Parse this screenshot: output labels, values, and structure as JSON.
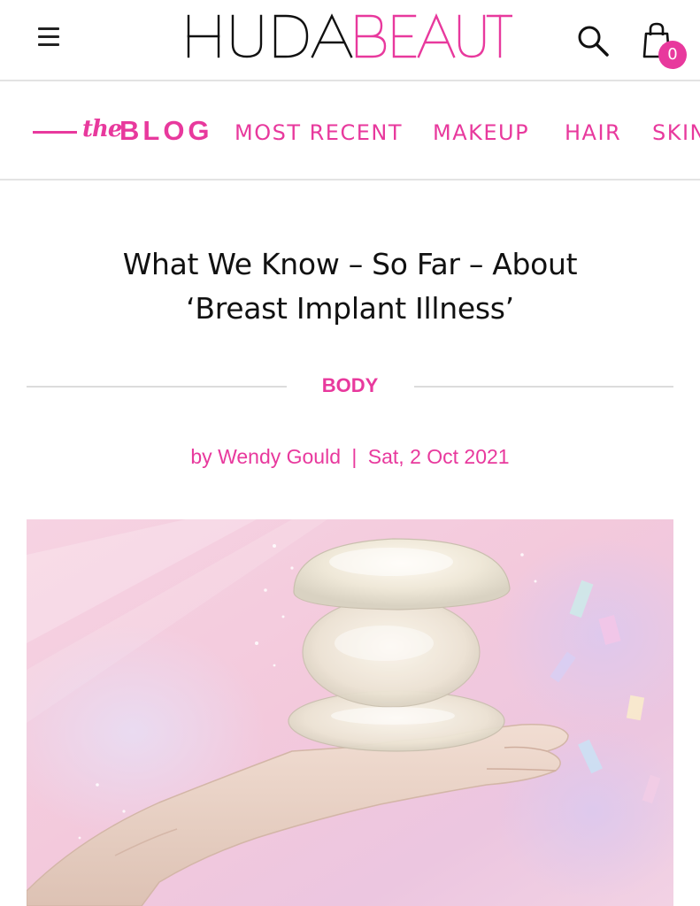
{
  "header": {
    "logo_text": "HUDABEAUTY",
    "cart_count": "0",
    "icons": {
      "menu": "hamburger-menu-icon",
      "search": "search-icon",
      "cart": "shopping-bag-icon"
    }
  },
  "blog_nav": {
    "brand_script": "the",
    "brand_word": "BLOG",
    "items": [
      {
        "label": "MOST RECENT"
      },
      {
        "label": "MAKEUP"
      },
      {
        "label": "HAIR"
      },
      {
        "label": "SKIN"
      }
    ]
  },
  "article": {
    "title_line1": "What We Know – So Far – About",
    "title_line2": "‘Breast Implant Illness’",
    "category": "BODY",
    "byline_author": "by Wendy Gould",
    "byline_separator": "|",
    "byline_date": "Sat, 2 Oct 2021"
  },
  "colors": {
    "accent": "#e8399d",
    "text": "#111111",
    "divider": "#e3e3e3"
  }
}
